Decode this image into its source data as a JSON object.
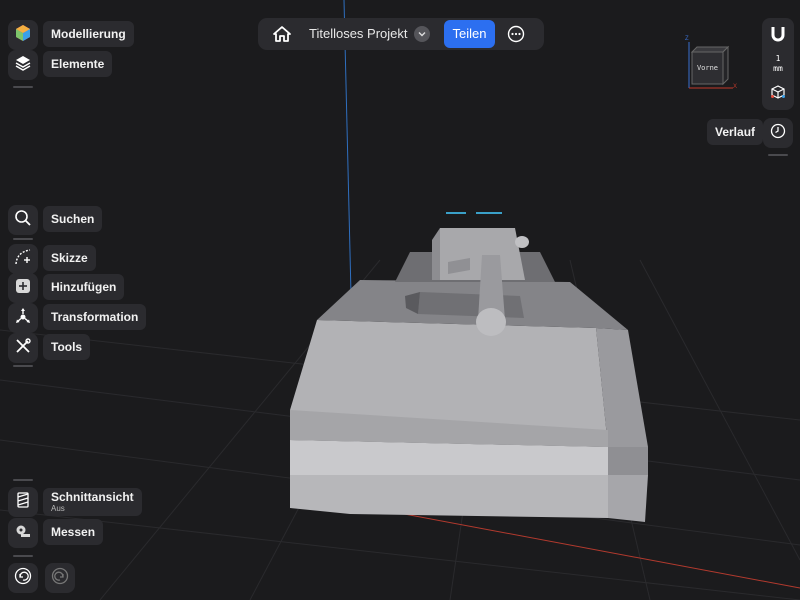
{
  "topbar": {
    "project_title": "Titelloses Projekt",
    "share_label": "Teilen",
    "icons": [
      "home-icon",
      "chevron-down-icon",
      "more-icon"
    ]
  },
  "left_panel": {
    "modeling_label": "Modellierung",
    "elements_label": "Elemente",
    "search_label": "Suchen",
    "sketch_label": "Skizze",
    "add_label": "Hinzufügen",
    "transform_label": "Transformation",
    "tools_label": "Tools",
    "section_view_label": "Schnittansicht",
    "section_view_state": "Aus",
    "measure_label": "Messen"
  },
  "right_panel": {
    "unit_value": "1",
    "unit_label": "mm",
    "history_label": "Verlauf",
    "view_cube_face": "Vorne",
    "view_cube_axes": [
      "Z",
      "X"
    ]
  },
  "colors": {
    "background": "#1b1b1d",
    "panel": "#2b2b2f",
    "accent": "#2c6ff0",
    "axis_blue": "#2f6fbf",
    "axis_red": "#b33a2e",
    "model_gray": "#9b9ba0"
  }
}
